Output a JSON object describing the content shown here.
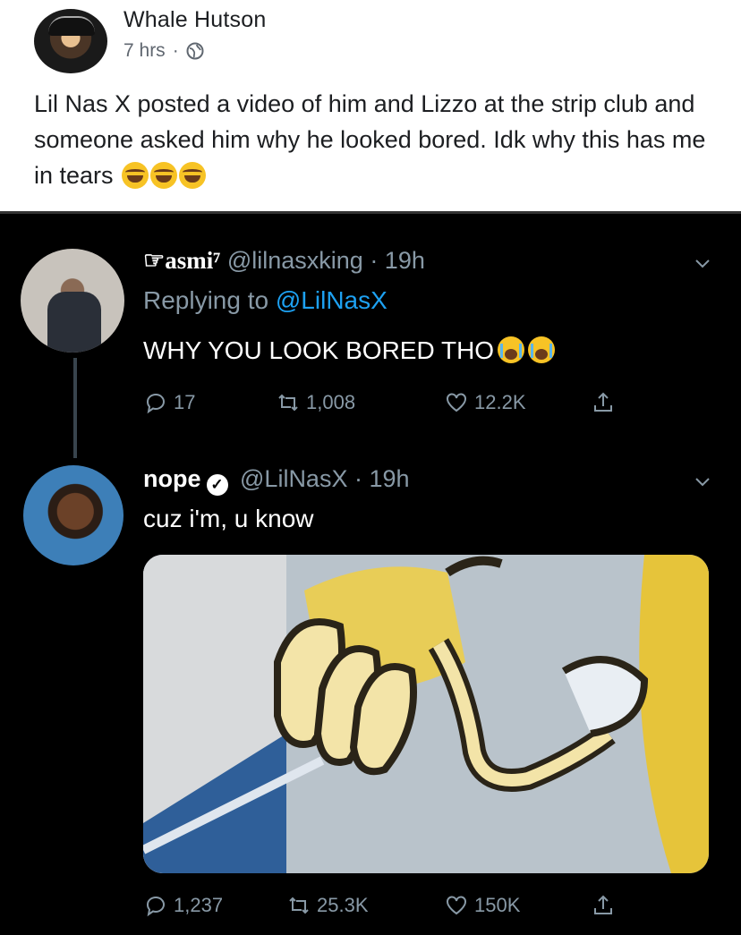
{
  "facebook_post": {
    "author": "Whale Hutson",
    "time": "7 hrs",
    "separator": "·",
    "text": "Lil Nas X posted a video of him and Lizzo at the strip club and someone asked him why he looked bored. Idk why this has me in tears"
  },
  "tweet1": {
    "display_name": "☞asmi⁷",
    "handle": "@lilnasxking",
    "time": "· 19h",
    "replying_label": "Replying to",
    "replying_handle": "@LilNasX",
    "text": "WHY YOU LOOK BORED THO",
    "replies": "17",
    "retweets": "1,008",
    "likes": "12.2K"
  },
  "tweet2": {
    "display_name": "nope",
    "verified_mark": "✓",
    "handle": "@LilNasX",
    "time": "· 19h",
    "text": "cuz i'm, u know",
    "replies": "1,237",
    "retweets": "25.3K",
    "likes": "150K"
  },
  "colors": {
    "twitter_bg": "#000000",
    "twitter_secondary_text": "#8899a6",
    "twitter_link": "#1da1f2",
    "facebook_text": "#1c1e21",
    "facebook_meta": "#606770"
  },
  "icons": [
    "globe-icon",
    "laughing-emoji-icon",
    "crying-emoji-icon",
    "chevron-down-icon",
    "reply-icon",
    "retweet-icon",
    "like-icon",
    "share-icon",
    "verified-badge-icon"
  ]
}
